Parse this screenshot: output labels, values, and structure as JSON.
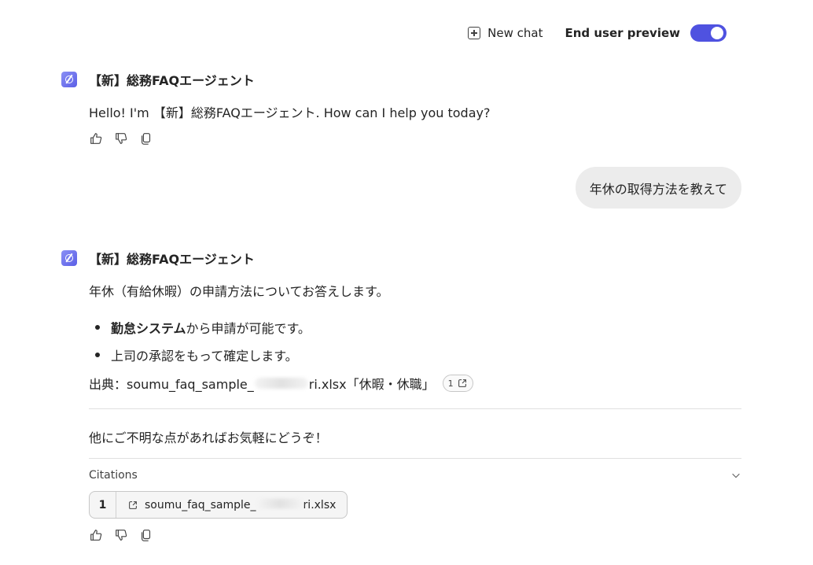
{
  "topbar": {
    "new_chat_label": "New chat",
    "end_user_preview_label": "End user preview",
    "toggle_on": true
  },
  "agent_name": "【新】総務FAQエージェント",
  "messages": {
    "greeting": "Hello! I'm 【新】総務FAQエージェント. How can I help you today?",
    "user_question": "年休の取得方法を教えて",
    "answer_intro": "年休（有給休暇）の申請方法についてお答えします。",
    "bullet1_bold": "勤怠システム",
    "bullet1_rest": "から申請が可能です。",
    "bullet2": "上司の承認をもって確定します。",
    "source_prefix": "出典：soumu_faq_sample_",
    "source_suffix": "ri.xlsx「休暇・休職」",
    "source_cite_num": "1",
    "closing": "他にご不明な点があればお気軽にどうぞ！"
  },
  "citations": {
    "label": "Citations",
    "items": [
      {
        "num": "1",
        "file_prefix": "soumu_faq_sample_",
        "file_suffix": "ri.xlsx"
      }
    ]
  },
  "icons": {
    "thumbs_up": "thumbs-up-icon",
    "thumbs_down": "thumbs-down-icon",
    "copy": "copy-icon",
    "external_link": "external-link-icon",
    "chevron": "chevron-down-icon"
  },
  "colors": {
    "accent": "#4f52e0",
    "user_bubble": "#ececec"
  }
}
